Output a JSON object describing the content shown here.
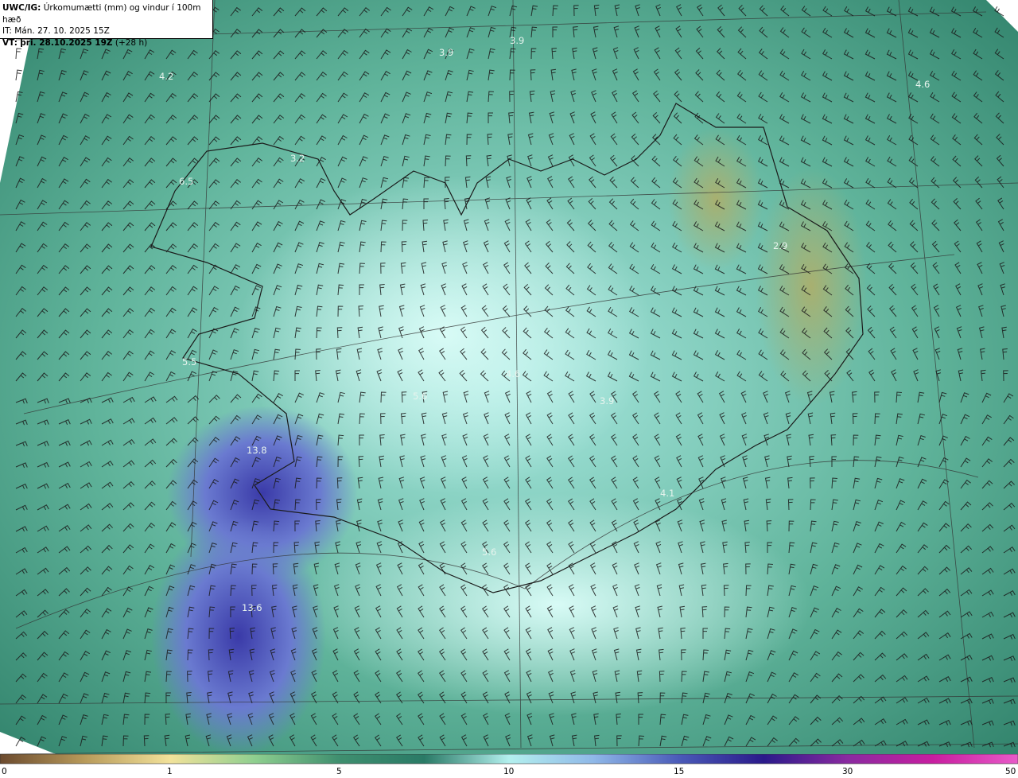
{
  "header": {
    "model": "UWC/IG:",
    "title": "Úrkomumætti (mm) og vindur í 100m hæð",
    "init_prefix": "IT:",
    "init_time": "Mán. 27. 10. 2025 15Z",
    "valid_prefix": "VT:",
    "valid_time": "þri. 28.10.2025 19Z",
    "valid_offset": "(+28 h)"
  },
  "map": {
    "labels": [
      {
        "text": "4.2"
      },
      {
        "text": "3.9"
      },
      {
        "text": "3.9"
      },
      {
        "text": "4.6"
      },
      {
        "text": "3.2"
      },
      {
        "text": "6.5"
      },
      {
        "text": "2.9"
      },
      {
        "text": "4.6"
      },
      {
        "text": "5.6"
      },
      {
        "text": "5.5"
      },
      {
        "text": "3.9"
      },
      {
        "text": "13.8"
      },
      {
        "text": "4.1"
      },
      {
        "text": "5.6"
      },
      {
        "text": "13.6"
      }
    ]
  },
  "colorbar": {
    "ticks": [
      "0",
      "1",
      "5",
      "10",
      "15",
      "30",
      "50"
    ],
    "colors": [
      "#6b4a2e",
      "#b89a5a",
      "#f2e29a",
      "#8fcf8f",
      "#3f8f6f",
      "#2a7a66",
      "#b3f0ee",
      "#8fb8e8",
      "#4a5ab8",
      "#2a1a8a",
      "#8a2aa0",
      "#c81ea0",
      "#e85ac8"
    ]
  }
}
